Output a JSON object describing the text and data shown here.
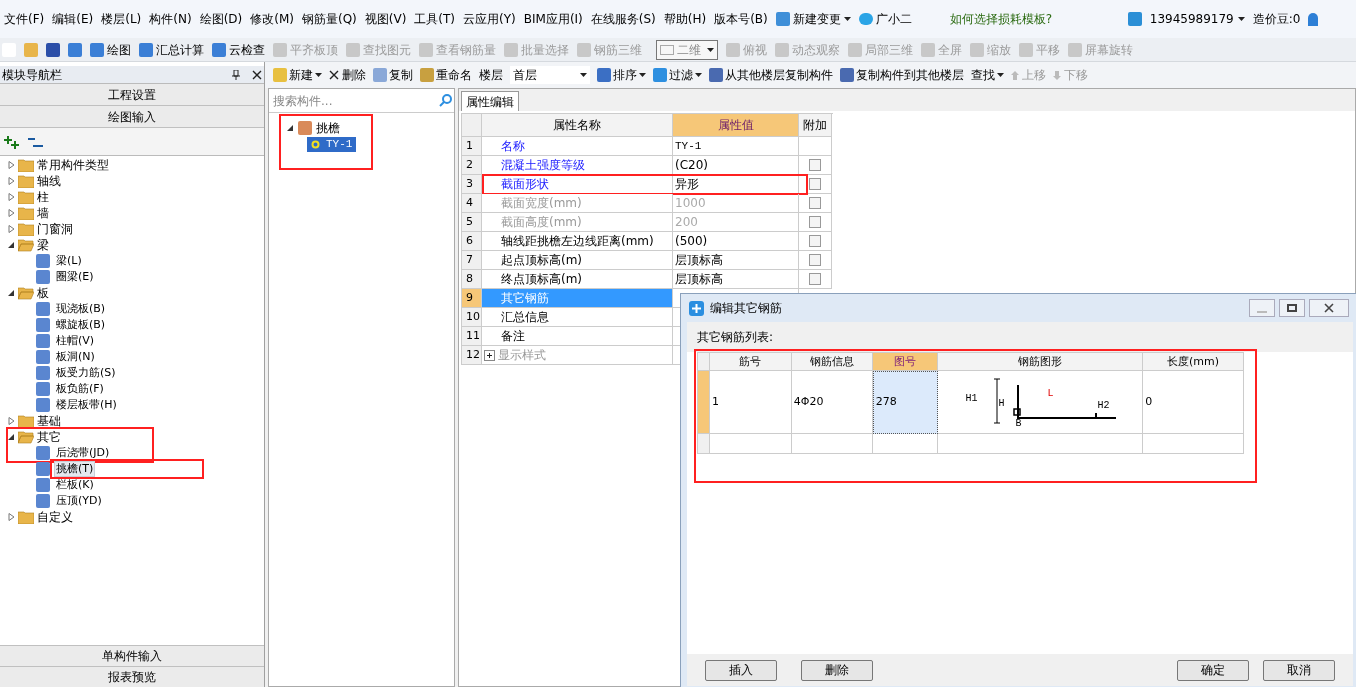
{
  "menu": {
    "items": [
      "文件(F)",
      "编辑(E)",
      "楼层(L)",
      "构件(N)",
      "绘图(D)",
      "修改(M)",
      "钢筋量(Q)",
      "视图(V)",
      "工具(T)",
      "云应用(Y)",
      "BIM应用(I)",
      "在线服务(S)",
      "帮助(H)",
      "版本号(B)"
    ],
    "change_button": "新建变更",
    "assistant": "广小二",
    "tip_link": "如何选择损耗模板?",
    "account": "13945989179",
    "balance": "造价豆:0"
  },
  "toolbar": [
    {
      "label": "绘图",
      "disabled": false
    },
    {
      "label": "汇总计算",
      "disabled": false
    },
    {
      "label": "云检查",
      "disabled": false
    },
    {
      "label": "平齐板顶",
      "disabled": true
    },
    {
      "label": "查找图元",
      "disabled": true
    },
    {
      "label": "查看钢筋量",
      "disabled": true
    },
    {
      "label": "批量选择",
      "disabled": true
    },
    {
      "label": "钢筋三维",
      "disabled": true
    }
  ],
  "view_select": "二维",
  "view_tools": [
    {
      "label": "俯视",
      "disabled": true
    },
    {
      "label": "动态观察",
      "disabled": true
    },
    {
      "label": "局部三维",
      "disabled": true
    },
    {
      "label": "全屏",
      "disabled": true
    },
    {
      "label": "缩放",
      "disabled": true
    },
    {
      "label": "平移",
      "disabled": true
    },
    {
      "label": "屏幕旋转",
      "disabled": true
    }
  ],
  "component_toolbar": {
    "new": "新建",
    "delete": "删除",
    "copy": "复制",
    "rename": "重命名",
    "floor_label": "楼层",
    "floor": "首层",
    "sort": "排序",
    "filter": "过滤",
    "copy_from": "从其他楼层复制构件",
    "copy_to": "复制构件到其他楼层",
    "find": "查找",
    "up": {
      "label": "上移",
      "disabled": true
    },
    "down": {
      "label": "下移",
      "disabled": true
    }
  },
  "nav": {
    "title": "模块导航栏",
    "sections": [
      "工程设置",
      "绘图输入"
    ],
    "bottom_sections": [
      "单构件输入",
      "报表预览"
    ],
    "tree": [
      {
        "label": "常用构件类型",
        "expanded": false
      },
      {
        "label": "轴线",
        "expanded": false
      },
      {
        "label": "柱",
        "expanded": false
      },
      {
        "label": "墙",
        "expanded": false
      },
      {
        "label": "门窗洞",
        "expanded": false
      },
      {
        "label": "梁",
        "expanded": true,
        "highlighted": false,
        "children": [
          {
            "label": "梁(L)",
            "selected": false,
            "highlighted": false
          },
          {
            "label": "圈梁(E)",
            "selected": false,
            "highlighted": false
          }
        ]
      },
      {
        "label": "板",
        "expanded": true,
        "highlighted": false,
        "children": [
          {
            "label": "现浇板(B)",
            "selected": false,
            "highlighted": false
          },
          {
            "label": "螺旋板(B)",
            "selected": false,
            "highlighted": false
          },
          {
            "label": "柱帽(V)",
            "selected": false,
            "highlighted": false
          },
          {
            "label": "板洞(N)",
            "selected": false,
            "highlighted": false
          },
          {
            "label": "板受力筋(S)",
            "selected": false,
            "highlighted": false
          },
          {
            "label": "板负筋(F)",
            "selected": false,
            "highlighted": false
          },
          {
            "label": "楼层板带(H)",
            "selected": false,
            "highlighted": false
          }
        ]
      },
      {
        "label": "基础",
        "expanded": false
      },
      {
        "label": "其它",
        "expanded": true,
        "highlighted": true,
        "children": [
          {
            "label": "后浇带(JD)",
            "selected": false,
            "highlighted": false
          },
          {
            "label": "挑檐(T)",
            "selected": true,
            "highlighted": true
          },
          {
            "label": "栏板(K)",
            "selected": false,
            "highlighted": false
          },
          {
            "label": "压顶(YD)",
            "selected": false,
            "highlighted": false
          }
        ]
      },
      {
        "label": "自定义",
        "expanded": false
      }
    ]
  },
  "components": {
    "search_placeholder": "搜索构件...",
    "tree": [
      {
        "label": "挑檐",
        "expanded": true,
        "highlighted": true,
        "children": [
          {
            "label": "TY-1",
            "selected": true
          }
        ]
      }
    ]
  },
  "properties": {
    "tab": "属性编辑",
    "columns": [
      "属性名称",
      "属性值",
      "附加"
    ],
    "rows": [
      {
        "num": "1",
        "name": "名称",
        "value": "TY-1",
        "kind": "link",
        "selected": false,
        "highlighted": false
      },
      {
        "num": "2",
        "name": "混凝土强度等级",
        "value": "(C20)",
        "kind": "link",
        "selected": false,
        "highlighted": false,
        "addon": false
      },
      {
        "num": "3",
        "name": "截面形状",
        "value": "异形",
        "kind": "link",
        "selected": false,
        "highlighted": true,
        "addon": false
      },
      {
        "num": "4",
        "name": "截面宽度(mm)",
        "value": "1000",
        "kind": "disabled",
        "selected": false,
        "highlighted": false,
        "addon": false
      },
      {
        "num": "5",
        "name": "截面高度(mm)",
        "value": "200",
        "kind": "disabled",
        "selected": false,
        "highlighted": false,
        "addon": false
      },
      {
        "num": "6",
        "name": "轴线距挑檐左边线距离(mm)",
        "value": "(500)",
        "kind": "normal",
        "selected": false,
        "highlighted": false,
        "addon": false
      },
      {
        "num": "7",
        "name": "起点顶标高(m)",
        "value": "层顶标高",
        "kind": "normal",
        "selected": false,
        "highlighted": false,
        "addon": false
      },
      {
        "num": "8",
        "name": "终点顶标高(m)",
        "value": "层顶标高",
        "kind": "normal",
        "selected": false,
        "highlighted": false,
        "addon": false
      },
      {
        "num": "9",
        "name": "其它钢筋",
        "kind": "normal",
        "selected": true,
        "highlighted": false
      },
      {
        "num": "10",
        "name": "汇总信息",
        "kind": "normal",
        "selected": false,
        "highlighted": false
      },
      {
        "num": "11",
        "name": "备注",
        "kind": "normal",
        "selected": false,
        "highlighted": false
      },
      {
        "num": "12",
        "name": "显示样式",
        "kind": "group",
        "selected": false,
        "highlighted": false
      }
    ]
  },
  "dialog": {
    "title": "编辑其它钢筋",
    "list_label": "其它钢筋列表:",
    "highlighted": true,
    "columns": [
      {
        "label": "筋号",
        "selected": false
      },
      {
        "label": "钢筋信息",
        "selected": false
      },
      {
        "label": "图号",
        "selected": true
      },
      {
        "label": "钢筋图形",
        "selected": false
      },
      {
        "label": "长度(mm)",
        "selected": false
      }
    ],
    "rows": [
      {
        "bar_no": "1",
        "info": "4Φ20",
        "shape_no": "278",
        "shape_labels": [
          "H1",
          "H",
          "L",
          "B",
          "H2"
        ],
        "length": "0",
        "selected": true
      },
      {
        "selected": false
      }
    ],
    "buttons": [
      "插入",
      "删除"
    ],
    "confirm_buttons": [
      "确定",
      "取消"
    ]
  }
}
